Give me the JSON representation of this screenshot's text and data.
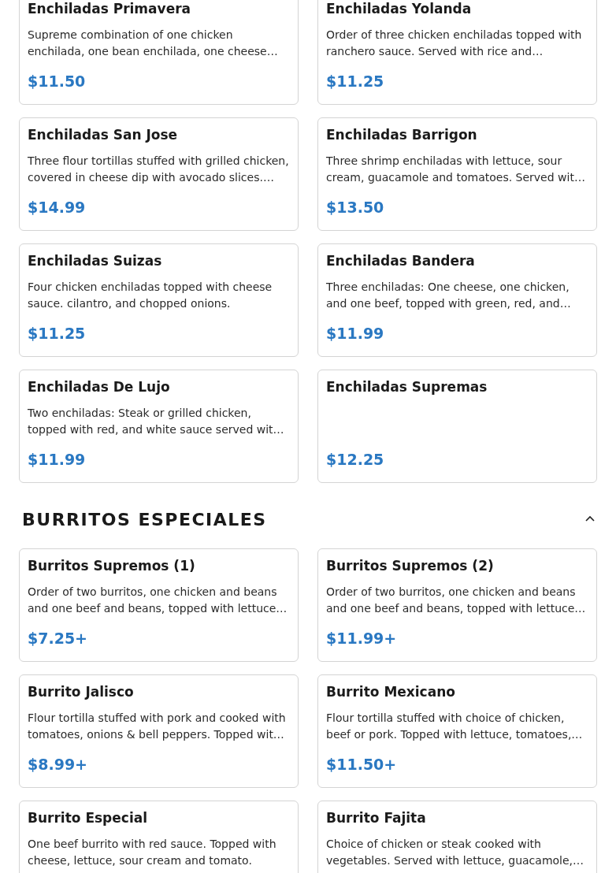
{
  "sections": [
    {
      "items": [
        {
          "name": "Enchiladas Primavera",
          "description": "Supreme combination of one chicken enchilada, one bean enchilada, one cheese…",
          "price": "$11.50"
        },
        {
          "name": "Enchiladas Yolanda",
          "description": "Order of three chicken enchiladas topped with ranchero sauce. Served with rice and…",
          "price": "$11.25"
        },
        {
          "name": "Enchiladas San Jose",
          "description": "Three flour tortillas stuffed with grilled chicken, covered in cheese dip with avocado slices.…",
          "price": "$14.99"
        },
        {
          "name": "Enchiladas Barrigon",
          "description": "Three shrimp enchiladas with lettuce, sour cream, guacamole and tomatoes. Served wit…",
          "price": "$13.50"
        },
        {
          "name": "Enchiladas Suizas",
          "description": "Four chicken enchiladas topped with cheese sauce. cilantro, and chopped onions.",
          "price": "$11.25"
        },
        {
          "name": "Enchiladas Bandera",
          "description": "Three enchiladas: One cheese, one chicken, and one beef, topped with green, red, and…",
          "price": "$11.99"
        },
        {
          "name": "Enchiladas De Lujo",
          "description": "Two enchiladas: Steak or grilled chicken, topped with red, and white sauce served wit…",
          "price": "$11.99"
        },
        {
          "name": "Enchiladas Supremas",
          "price": "$12.25"
        }
      ]
    },
    {
      "title": "BURRITOS ESPECIALES",
      "expanded": true,
      "items": [
        {
          "name": "Burritos Supremos (1)",
          "description": "Order of two burritos, one chicken and beans and one beef and beans, topped with lettuce…",
          "price": "$7.25+"
        },
        {
          "name": "Burritos Supremos (2)",
          "description": "Order of two burritos, one chicken and beans and one beef and beans, topped with lettuce…",
          "price": "$11.99+"
        },
        {
          "name": "Burrito Jalisco",
          "description": "Flour tortilla stuffed with pork and cooked with tomatoes, onions & bell peppers. Topped wit…",
          "price": "$8.99+"
        },
        {
          "name": "Burrito Mexicano",
          "description": "Flour tortilla stuffed with choice of chicken, beef or pork. Topped with lettuce, tomatoes,…",
          "price": "$11.50+"
        },
        {
          "name": "Burrito Especial",
          "description": "One beef burrito with red sauce. Topped with cheese, lettuce, sour cream and tomato."
        },
        {
          "name": "Burrito Fajita",
          "description": "Choice of chicken or steak cooked with vegetables. Served with lettuce, guacamole,…"
        }
      ]
    }
  ]
}
